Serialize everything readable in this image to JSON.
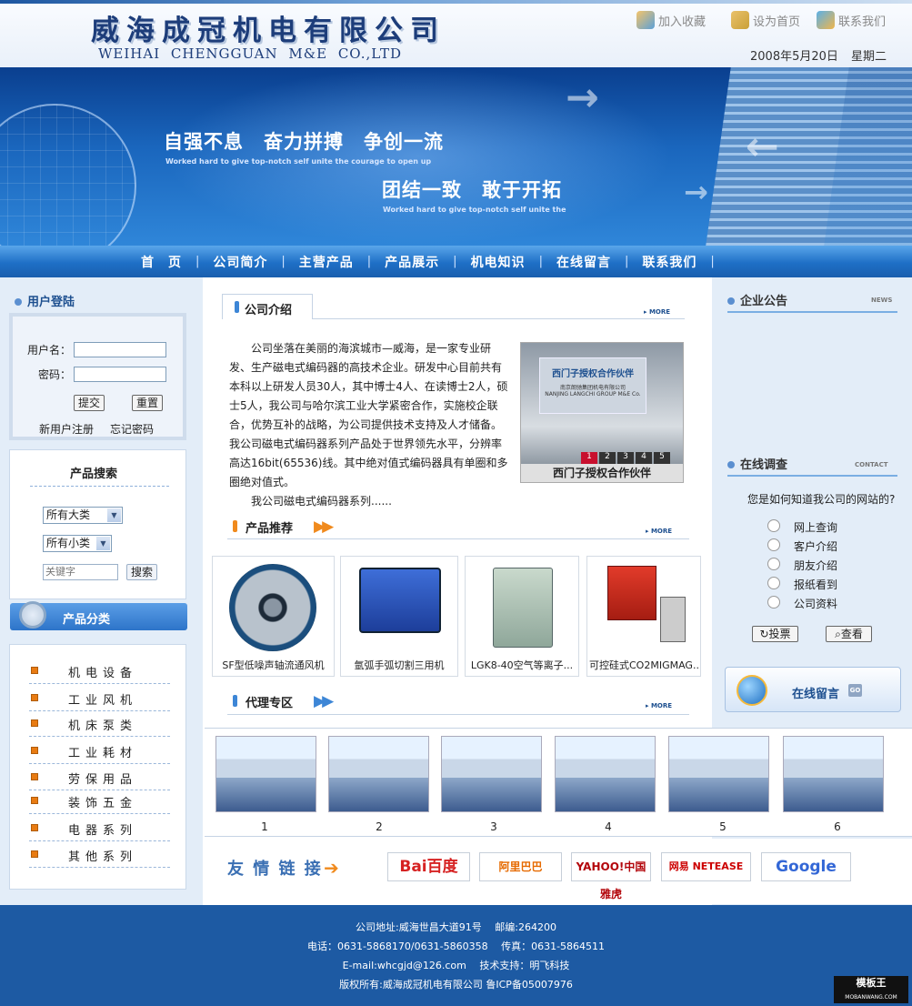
{
  "header": {
    "company_cn": "威海成冠机电有限公司",
    "company_en": "WEIHAI CHENGGUAN M&E CO.,LTD",
    "links": {
      "favorite": "加入收藏",
      "homepage": "设为首页",
      "contact": "联系我们"
    },
    "date": "2008年5月20日",
    "weekday": "星期二"
  },
  "banner": {
    "slogan1": "自强不息　奋力拼搏　争创一流",
    "slogan1_sub": "Worked hard to give top-notch self unite the   courage to open up",
    "slogan2": "团结一致　敢于开拓",
    "slogan2_sub": "Worked hard to give top-notch self unite the"
  },
  "nav": {
    "items": [
      "首　页",
      "公司简介",
      "主营产品",
      "产品展示",
      "机电知识",
      "在线留言",
      "联系我们"
    ]
  },
  "login": {
    "title": "用户登陆",
    "username_label": "用户名：",
    "password_label": "密码：",
    "submit": "提交",
    "reset": "重置",
    "register": "新用户注册",
    "forgot": "忘记密码"
  },
  "product_search": {
    "title": "产品搜索",
    "category1": "所有大类",
    "category2": "所有小类",
    "keyword_placeholder": "关键字",
    "search_button": "搜索"
  },
  "categories": {
    "title": "产品分类",
    "items": [
      "机电设备",
      "工业风机",
      "机床泵类",
      "工业耗材",
      "劳保用品",
      "装饰五金",
      "电器系列",
      "其他系列"
    ]
  },
  "intro": {
    "tab": "公司介绍",
    "more": "MORE",
    "p1": "公司坐落在美丽的海滨城市—威海，是一家专业研发、生产磁电式编码器的高技术企业。研发中心目前共有本科以上研发人员30人，其中博士4人、在读博士2人，硕士5人，我公司与哈尔滨工业大学紧密合作，实施校企联合，优势互补的战略，为公司提供技术支持及人才储备。",
    "p2": "我公司磁电式编码器系列产品处于世界领先水平，分辨率高达16bit(65536)线。其中绝对值式编码器具有单圈和多圈绝对值式。",
    "p3": "我公司磁电式编码器系列......",
    "photo_caption": "西门子授权合作伙伴",
    "photo_sign": "西门子授权合作伙伴",
    "photo_sign_sub": "南京朗驰集团机电有限公司\nNANJING LANGCHI GROUP M&E Co.",
    "photo_pages": [
      "1",
      "2",
      "3",
      "4",
      "5"
    ]
  },
  "recommend": {
    "title": "产品推荐",
    "more": "MORE",
    "products": [
      "SF型低噪声轴流通风机",
      "氩弧手弧切割三用机",
      "LGK8-40空气等离子...",
      "可控硅式CO2MIGMAG..."
    ]
  },
  "agent": {
    "title": "代理专区",
    "more": "MORE",
    "numbers": [
      "1",
      "2",
      "3",
      "4",
      "5",
      "6"
    ]
  },
  "friend_links": {
    "title": "友 情 链 接",
    "sites": [
      "Bai百度",
      "阿里巴巴",
      "YAHOO!中国雅虎",
      "网易 NETEASE",
      "Google"
    ]
  },
  "notice": {
    "title": "企业公告",
    "tag": "NEWS"
  },
  "survey": {
    "title": "在线调查",
    "tag": "CONTACT",
    "question": "您是如何知道我公司的网站的?",
    "options": [
      "网上查询",
      "客户介绍",
      "朋友介绍",
      "报纸看到",
      "公司资料"
    ],
    "vote": "投票",
    "view": "查看"
  },
  "guestbook": {
    "label": "在线留言",
    "go": "GO"
  },
  "footer": {
    "line1": "公司地址:威海世昌大道91号　 邮编:264200",
    "line2": "电话：0631-5868170/0631-5860358　 传真：0631-5864511",
    "line3": "E-mail:whcgjd@126.com　 技术支持：明飞科技",
    "line4": "版权所有:威海成冠机电有限公司 鲁ICP备05007976",
    "badge": "模板王",
    "badge_sub": "MOBANWANG.COM"
  }
}
